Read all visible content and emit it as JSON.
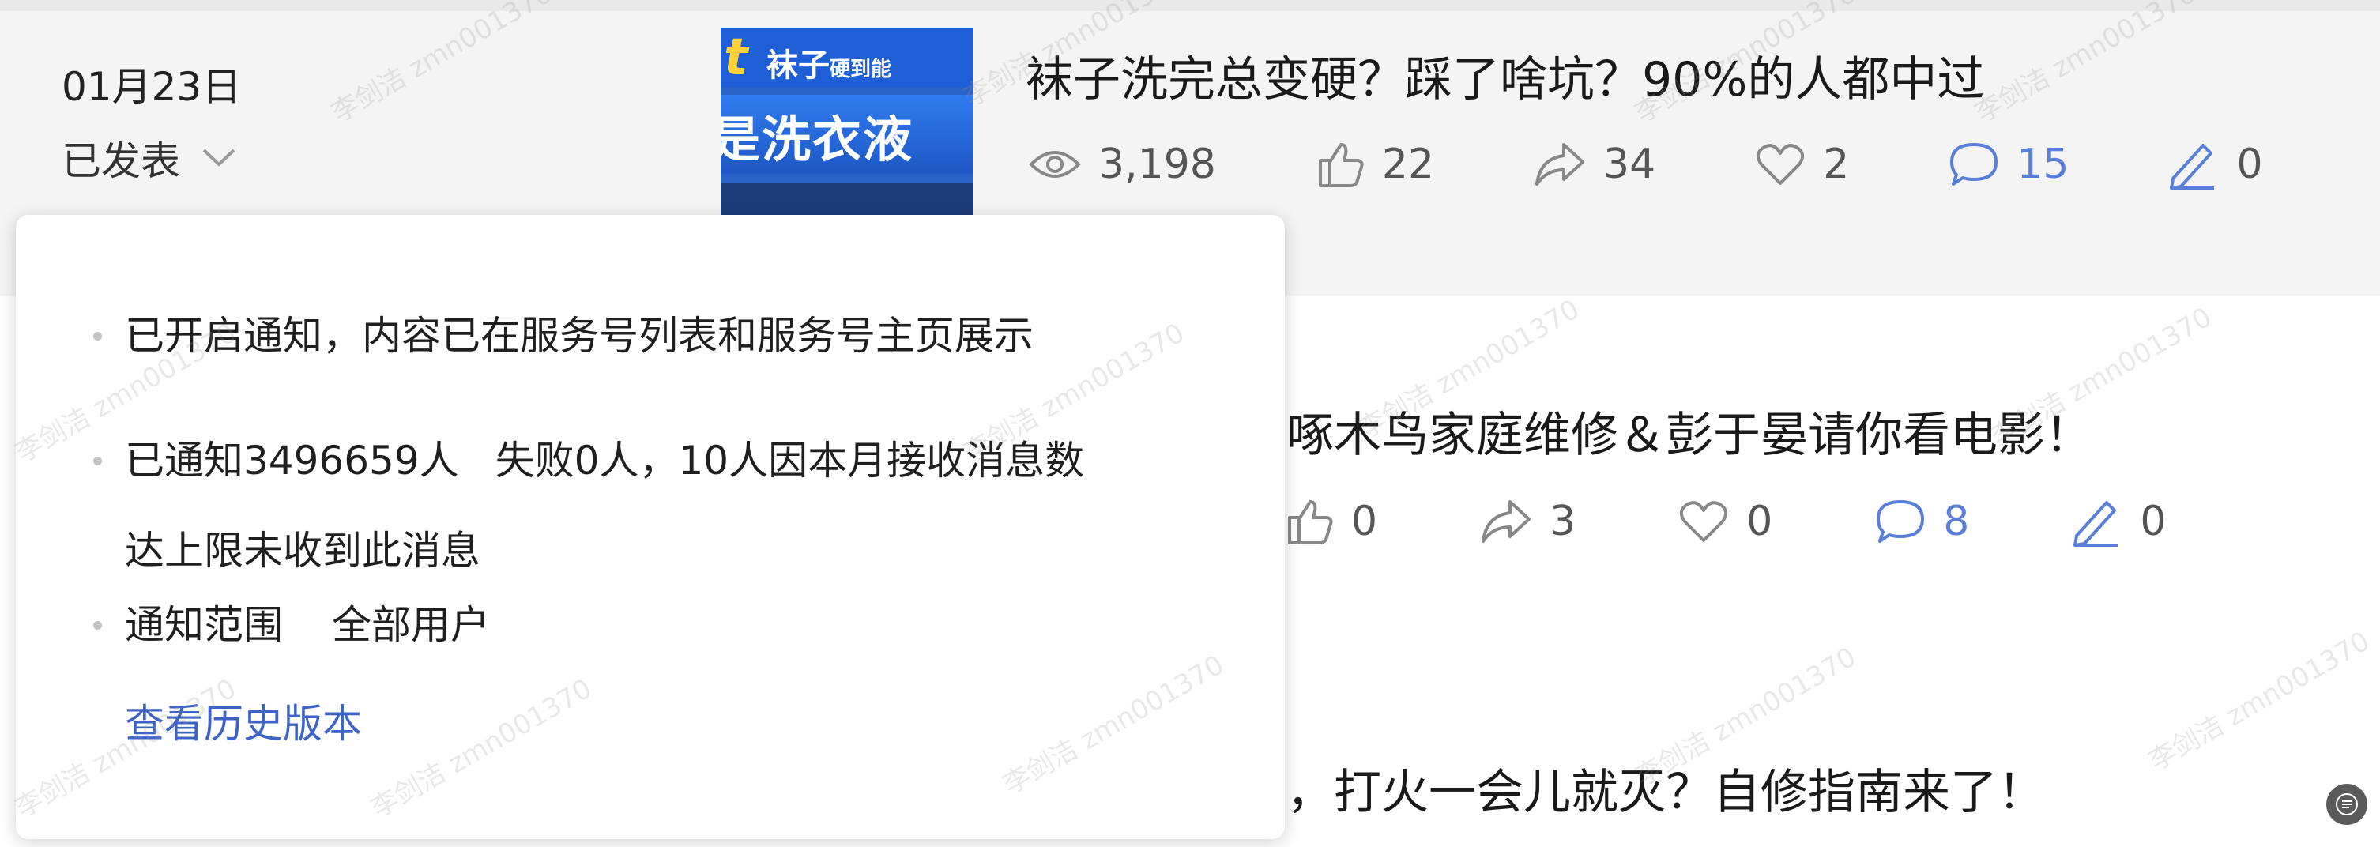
{
  "articles": [
    {
      "date": "01月23日",
      "status": "已发表",
      "thumbnail": {
        "line1_big": "袜子",
        "line1_small": "硬到能",
        "line2": "是洗衣液"
      },
      "title": "袜子洗完总变硬？踩了啥坑？90%的人都中过",
      "stats": {
        "views": "3,198",
        "likes": "22",
        "shares": "34",
        "favorites": "2",
        "comments": "15",
        "edits": "0"
      }
    },
    {
      "title": "啄木鸟家庭维修＆彭于晏请你看电影！",
      "stats": {
        "likes": "0",
        "shares": "3",
        "favorites": "0",
        "comments": "8",
        "edits": "0"
      }
    },
    {
      "title": "，打火一会儿就灭？自修指南来了！"
    }
  ],
  "popover": {
    "item1": "已开启通知，内容已在服务号列表和服务号主页展示",
    "item2_notified": "已通知3496659人",
    "item2_failed": "失败0人，10人因本月接收消息数",
    "item2_cont": "达上限未收到此消息",
    "item3_label": "通知范围",
    "item3_value": "全部用户",
    "history_link": "查看历史版本"
  },
  "watermark_text": "李剑洁 zmn001370",
  "colors": {
    "link": "#3d63c7",
    "comment_icon": "#5a7fd8",
    "popover_bg": "#ffffff",
    "page_bg": "#f4f4f4"
  },
  "icons": [
    "eye-icon",
    "thumbs-up-icon",
    "share-icon",
    "heart-icon",
    "comment-icon",
    "pen-icon",
    "chevron-down-icon"
  ]
}
